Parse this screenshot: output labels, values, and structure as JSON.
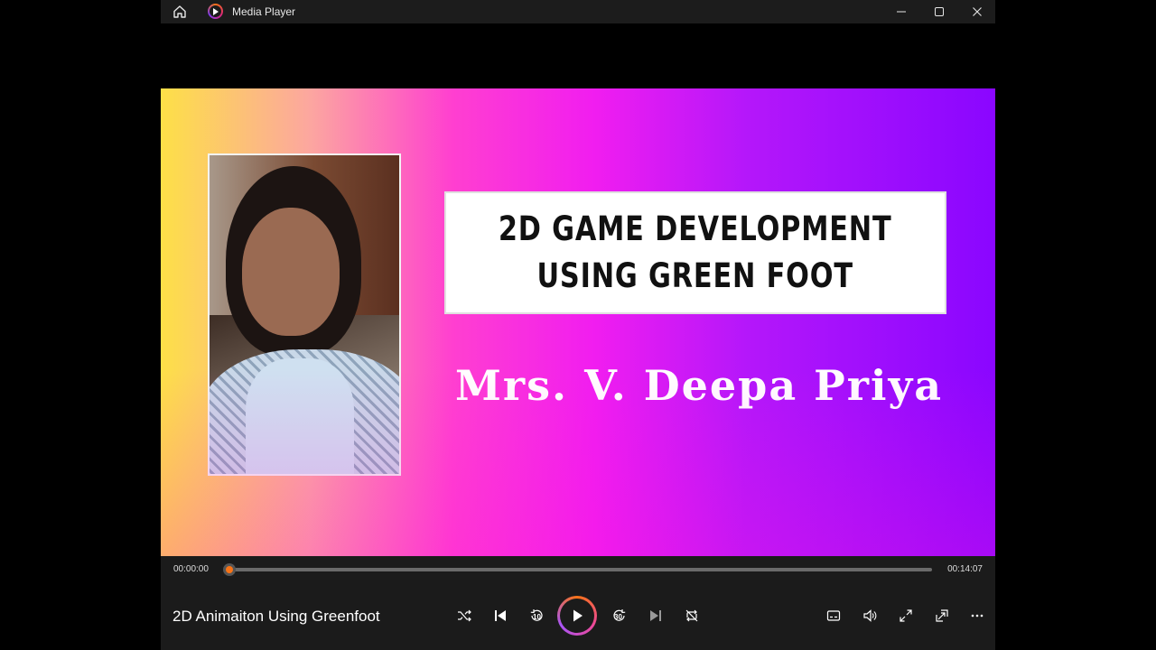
{
  "window": {
    "title": "Media Player"
  },
  "titlebar": {
    "icons": [
      "home-icon",
      "media-player-icon",
      "minimize-icon",
      "maximize-icon",
      "close-icon"
    ]
  },
  "video": {
    "slide": {
      "title_line1": "2D GAME DEVELOPMENT",
      "title_line2": "USING GREEN FOOT",
      "presenter": "Mrs. V. Deepa Priya"
    },
    "gradient_colors": [
      "#fde047",
      "#ff3fd0",
      "#8a06ff"
    ]
  },
  "player": {
    "time_current": "00:00:00",
    "time_total": "00:14:07",
    "progress": 0.003,
    "media_title": "2D Animaiton Using Greenfoot",
    "skip_back_seconds": "10",
    "skip_forward_seconds": "30",
    "accent_color": "#f97316",
    "controls": [
      "shuffle-icon",
      "previous-icon",
      "skip-back-10-icon",
      "play-icon",
      "skip-forward-30-icon",
      "next-icon",
      "repeat-icon",
      "captions-icon",
      "volume-icon",
      "fullscreen-icon",
      "mini-player-icon",
      "more-icon"
    ]
  }
}
